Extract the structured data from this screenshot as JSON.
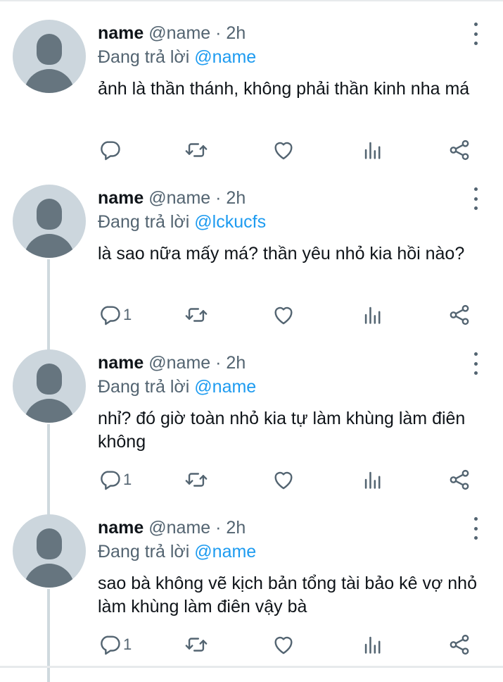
{
  "tweets": [
    {
      "name": "name",
      "handle": "@name",
      "separator": "·",
      "time": "2h",
      "reply_prefix": "Đang trả lời",
      "reply_to": "@lckucfs",
      "text": "là sao nữa mấy má? thần yêu nhỏ kia hồi nào?",
      "reply_count": "1"
    },
    {
      "name": "name",
      "handle": "@name",
      "separator": "·",
      "time": "2h",
      "reply_prefix": "Đang trả lời",
      "reply_to": "@name",
      "text": "nhỉ? đó giờ toàn nhỏ kia tự làm khùng làm điên không",
      "reply_count": "1"
    },
    {
      "name": "name",
      "handle": "@name",
      "separator": "·",
      "time": "2h",
      "reply_prefix": "Đang trả lời",
      "reply_to": "@name",
      "text": "sao bà không vẽ kịch bản tổng tài bảo kê vợ nhỏ làm khùng làm điên vậy bà",
      "reply_count": "1"
    },
    {
      "name": "name",
      "handle": "@name",
      "separator": "·",
      "time": "2h",
      "reply_prefix": "Đang trả lời",
      "reply_to": "@name",
      "text": "ảnh là thần thánh, không phải thần kinh nha má",
      "reply_count": ""
    }
  ],
  "icons": {
    "reply": "speech-bubble-icon",
    "retweet": "retweet-icon",
    "like": "heart-icon",
    "views": "bar-chart-icon",
    "share": "share-icon",
    "more": "more-vertical-icon"
  },
  "colors": {
    "mention": "#1d9bf0",
    "muted": "#536471",
    "text": "#0f1419",
    "avatar_bg": "#ccd6dd",
    "avatar_fg": "#66757f",
    "thread_line": "#cfd9de"
  }
}
